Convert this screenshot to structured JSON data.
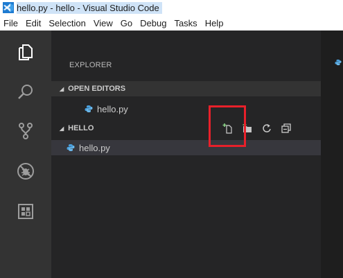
{
  "window": {
    "title": "hello.py - hello - Visual Studio Code"
  },
  "menu": {
    "items": [
      "File",
      "Edit",
      "Selection",
      "View",
      "Go",
      "Debug",
      "Tasks",
      "Help"
    ]
  },
  "activity_bar": {
    "icons": [
      "files-icon",
      "search-icon",
      "source-control-icon",
      "debug-icon",
      "extensions-icon"
    ]
  },
  "explorer": {
    "title": "EXPLORER",
    "open_editors": {
      "label": "OPEN EDITORS",
      "files": [
        "hello.py"
      ]
    },
    "folder": {
      "label": "HELLO",
      "files": [
        "hello.py"
      ],
      "actions": [
        "new-file-icon",
        "new-folder-icon",
        "refresh-icon",
        "collapse-all-icon"
      ]
    }
  },
  "colors": {
    "activity_bar": "#333333",
    "sidebar": "#252526",
    "editor": "#1e1e1e",
    "python_icon": "#4a9fdc",
    "highlight": "#e8202a"
  }
}
